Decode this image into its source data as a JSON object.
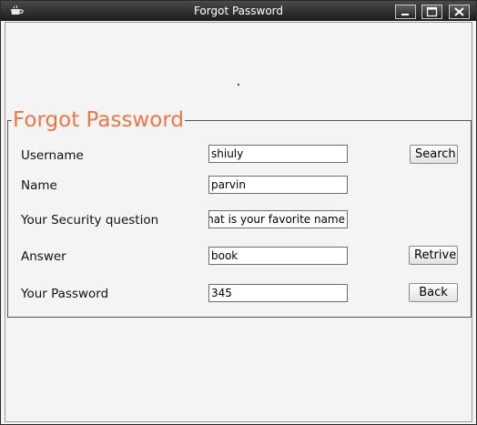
{
  "window": {
    "title": "Forgot Password"
  },
  "form": {
    "legend": "Forgot Password",
    "username_label": "Username",
    "username_value": "shiuly",
    "name_label": "Name",
    "name_value": "parvin",
    "question_label": "Your Security question",
    "question_value": "What is your favorite name?",
    "answer_label": "Answer",
    "answer_value": "book",
    "password_label": "Your Password",
    "password_value": "345",
    "search_button": "Search",
    "retrive_button": "Retrive",
    "back_button": "Back"
  },
  "colors": {
    "legend": "#f07540",
    "titlebar": "#2a2a2a",
    "background": "#f4f4f4"
  }
}
